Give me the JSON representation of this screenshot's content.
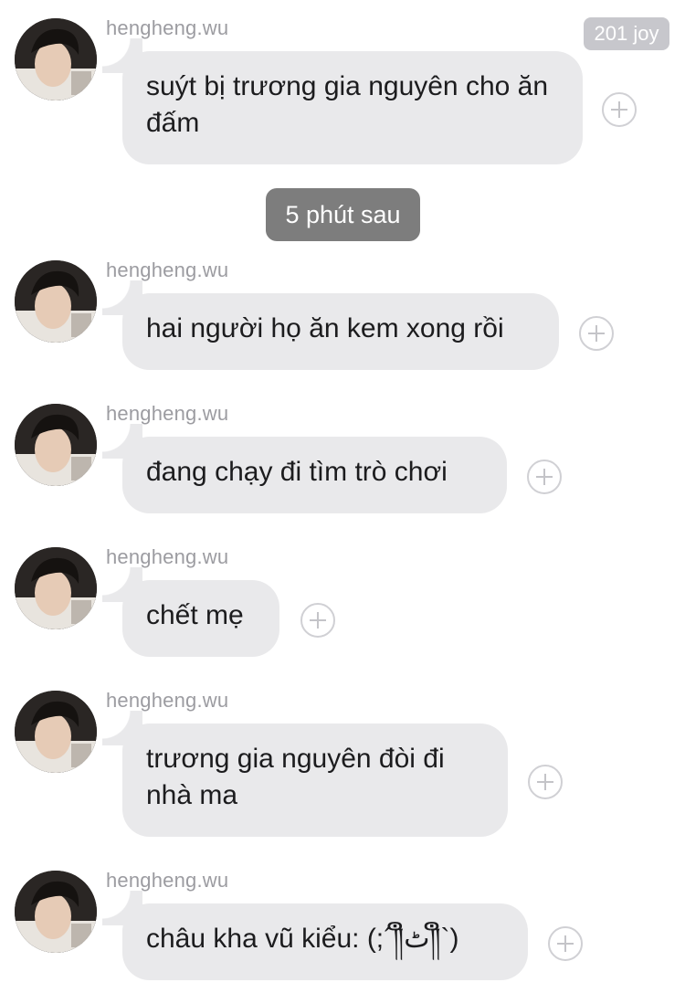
{
  "header": {
    "joy_count": "201 joy"
  },
  "divider": {
    "time_label": "5 phút sau"
  },
  "messages": [
    {
      "username": "hengheng.wu",
      "text": "suýt bị trương gia nguyên cho ăn đấm"
    },
    {
      "username": "hengheng.wu",
      "text": "hai người họ ăn kem xong rồi"
    },
    {
      "username": "hengheng.wu",
      "text": "đang chạy đi tìm trò chơi"
    },
    {
      "username": "hengheng.wu",
      "text": "chết mẹ"
    },
    {
      "username": "hengheng.wu",
      "text": "trương gia nguyên đòi đi nhà ma"
    },
    {
      "username": "hengheng.wu",
      "text": "châu kha vũ kiểu: (;´༎ຶٹ༎ຶ`)"
    }
  ],
  "colors": {
    "bubble": "#e9e9eb",
    "username": "#9c9ca1",
    "time_pill": "#7d7d7d",
    "badge": "#c7c7cc"
  },
  "icons": {
    "add_reaction": "plus-circle-icon",
    "avatar": "user-avatar-photo"
  }
}
